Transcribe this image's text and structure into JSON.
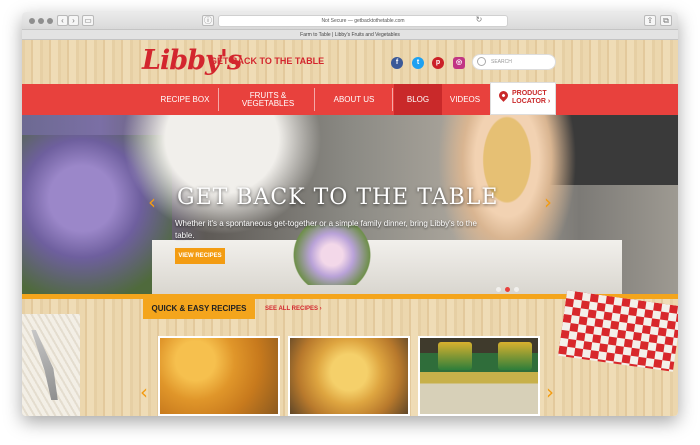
{
  "browser": {
    "url": "Not Secure — getbacktothetable.com",
    "tab_title": "Farm to Table | Libby's Fruits and Vegetables"
  },
  "header": {
    "logo_text": "Libby's",
    "tagline": "GET BACK TO THE TABLE",
    "social_icons": [
      "facebook-icon",
      "twitter-icon",
      "pinterest-icon",
      "instagram-icon"
    ],
    "search_placeholder": "SEARCH"
  },
  "nav": {
    "items": [
      {
        "label": "RECIPE BOX"
      },
      {
        "label": "FRUITS & VEGETABLES"
      },
      {
        "label": "ABOUT US"
      },
      {
        "label": "BLOG"
      },
      {
        "label": "VIDEOS"
      }
    ],
    "locator_label_1": "PRODUCT",
    "locator_label_2": "LOCATOR ›"
  },
  "hero": {
    "title": "GET BACK TO THE TABLE",
    "subtitle": "Whether it's a spontaneous get-together or a simple family dinner, bring Libby's to the table.",
    "button": "VIEW RECIPES"
  },
  "recipes": {
    "heading": "QUICK & EASY RECIPES",
    "see_all": "SEE ALL RECIPES ›",
    "cards": [
      "macaroni-dish",
      "baked-casserole",
      "canned-vegetables"
    ]
  },
  "colors": {
    "brand_red": "#e8413d",
    "dark_red": "#c9292a",
    "accent_orange": "#f4a51c"
  }
}
